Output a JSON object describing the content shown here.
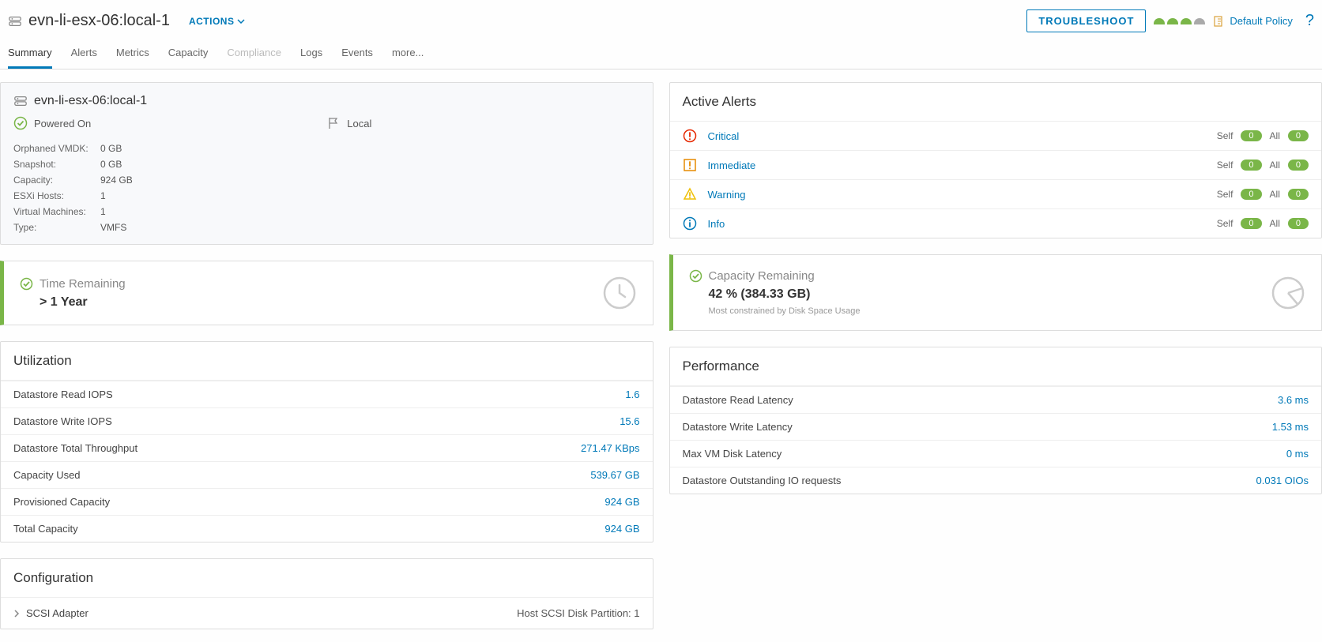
{
  "header": {
    "title": "evn-li-esx-06:local-1",
    "actions_label": "ACTIONS",
    "troubleshoot_label": "TROUBLESHOOT",
    "policy_label": "Default Policy"
  },
  "tabs": [
    {
      "label": "Summary",
      "active": true
    },
    {
      "label": "Alerts"
    },
    {
      "label": "Metrics"
    },
    {
      "label": "Capacity"
    },
    {
      "label": "Compliance",
      "disabled": true
    },
    {
      "label": "Logs"
    },
    {
      "label": "Events"
    },
    {
      "label": "more..."
    }
  ],
  "object": {
    "name": "evn-li-esx-06:local-1",
    "power": "Powered On",
    "locality": "Local",
    "props": [
      {
        "k": "Orphaned VMDK:",
        "v": "0 GB"
      },
      {
        "k": "Snapshot:",
        "v": "0 GB"
      },
      {
        "k": "Capacity:",
        "v": "924 GB"
      },
      {
        "k": "ESXi Hosts:",
        "v": "1"
      },
      {
        "k": "Virtual Machines:",
        "v": "1"
      },
      {
        "k": "Type:",
        "v": "VMFS"
      }
    ]
  },
  "alerts": {
    "title": "Active Alerts",
    "self_label": "Self",
    "all_label": "All",
    "rows": [
      {
        "name": "Critical",
        "icon": "critical",
        "self": "0",
        "all": "0"
      },
      {
        "name": "Immediate",
        "icon": "immediate",
        "self": "0",
        "all": "0"
      },
      {
        "name": "Warning",
        "icon": "warning",
        "self": "0",
        "all": "0"
      },
      {
        "name": "Info",
        "icon": "info",
        "self": "0",
        "all": "0"
      }
    ]
  },
  "time_remaining": {
    "title": "Time Remaining",
    "value": "> 1 Year"
  },
  "capacity_remaining": {
    "title": "Capacity Remaining",
    "value": "42 % (384.33 GB)",
    "sub": "Most constrained by Disk Space Usage"
  },
  "utilization": {
    "title": "Utilization",
    "rows": [
      {
        "label": "Datastore Read IOPS",
        "value": "1.6"
      },
      {
        "label": "Datastore Write IOPS",
        "value": "15.6"
      },
      {
        "label": "Datastore Total Throughput",
        "value": "271.47 KBps"
      },
      {
        "label": "Capacity Used",
        "value": "539.67 GB"
      },
      {
        "label": "Provisioned Capacity",
        "value": "924 GB"
      },
      {
        "label": "Total Capacity",
        "value": "924 GB"
      }
    ]
  },
  "performance": {
    "title": "Performance",
    "rows": [
      {
        "label": "Datastore Read Latency",
        "value": "3.6 ms"
      },
      {
        "label": "Datastore Write Latency",
        "value": "1.53 ms"
      },
      {
        "label": "Max VM Disk Latency",
        "value": "0 ms"
      },
      {
        "label": "Datastore Outstanding IO requests",
        "value": "0.031 OIOs"
      }
    ]
  },
  "configuration": {
    "title": "Configuration",
    "row_label": "SCSI Adapter",
    "row_right": "Host SCSI Disk Partition: 1"
  }
}
